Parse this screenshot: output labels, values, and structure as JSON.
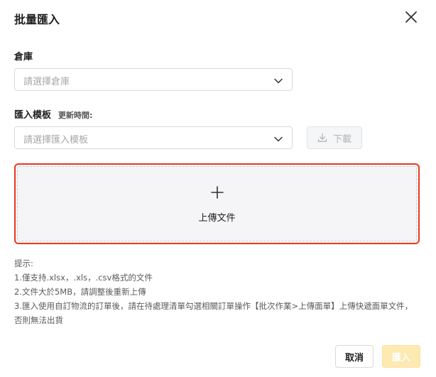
{
  "dialog": {
    "title": "批量匯入",
    "close_icon": "close-icon"
  },
  "warehouse": {
    "label": "倉庫",
    "placeholder": "請選擇倉庫"
  },
  "template": {
    "label": "匯入模板",
    "update_time_label": "更新時間:",
    "placeholder": "請選擇匯入模板",
    "download_label": "下載"
  },
  "upload": {
    "label": "上傳文件",
    "icon": "plus-icon",
    "border_color": "#e8391f"
  },
  "tips": {
    "title": "提示:",
    "lines": [
      "1.僅支持.xlsx，.xls，.csv格式的文件",
      "2.文件大於5MB，請調整後重新上傳",
      "3.匯入使用自訂物流的訂單後，請在待處理清單勾選相關訂單操作【批次作業>上傳面單】上傳快遞面單文件，否則無法出貨"
    ]
  },
  "footer": {
    "cancel_label": "取消",
    "import_label": "匯入",
    "import_color": "#fde9b2"
  }
}
